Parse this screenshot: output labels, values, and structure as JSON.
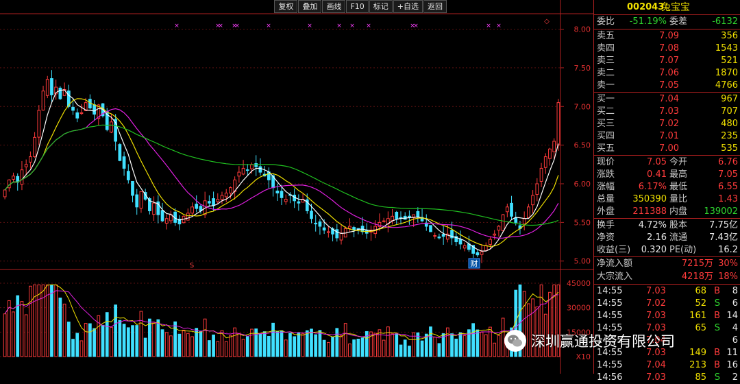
{
  "toolbar": [
    "复权",
    "叠加",
    "画线",
    "F10",
    "标记",
    "+自选",
    "返回"
  ],
  "stock": {
    "code": "002043",
    "name": "兔宝宝"
  },
  "committee": {
    "ratio_label": "委比",
    "ratio": "-51.19%",
    "diff_label": "委差",
    "diff": "-6132"
  },
  "asks": [
    {
      "label": "卖五",
      "price": "7.09",
      "vol": "356"
    },
    {
      "label": "卖四",
      "price": "7.08",
      "vol": "1543"
    },
    {
      "label": "卖三",
      "price": "7.07",
      "vol": "521"
    },
    {
      "label": "卖二",
      "price": "7.06",
      "vol": "1870"
    },
    {
      "label": "卖一",
      "price": "7.05",
      "vol": "4766"
    }
  ],
  "bids": [
    {
      "label": "买一",
      "price": "7.04",
      "vol": "967"
    },
    {
      "label": "买二",
      "price": "7.03",
      "vol": "707"
    },
    {
      "label": "买三",
      "price": "7.02",
      "vol": "480"
    },
    {
      "label": "买四",
      "price": "7.01",
      "vol": "235"
    },
    {
      "label": "买五",
      "price": "7.00",
      "vol": "535"
    }
  ],
  "quote": [
    {
      "l1": "现价",
      "v1": "7.05",
      "c1": "red",
      "l2": "今开",
      "v2": "6.76",
      "c2": "red"
    },
    {
      "l1": "涨跌",
      "v1": "0.41",
      "c1": "red",
      "l2": "最高",
      "v2": "7.05",
      "c2": "red"
    },
    {
      "l1": "涨幅",
      "v1": "6.17%",
      "c1": "red",
      "l2": "最低",
      "v2": "6.55",
      "c2": "red"
    },
    {
      "l1": "总量",
      "v1": "350390",
      "c1": "yellow",
      "l2": "量比",
      "v2": "1.43",
      "c2": "red"
    },
    {
      "l1": "外盘",
      "v1": "211388",
      "c1": "red",
      "l2": "内盘",
      "v2": "139002",
      "c2": "green"
    }
  ],
  "fundamentals": [
    {
      "l1": "换手",
      "v1": "4.72%",
      "l2": "股本",
      "v2": "7.75亿"
    },
    {
      "l1": "净资",
      "v1": "2.16",
      "l2": "流通",
      "v2": "7.43亿"
    },
    {
      "l1": "收益(三)",
      "v1": "0.320",
      "l2": "PE(动)",
      "v2": "16.2"
    }
  ],
  "flows": [
    {
      "label": "净流入额",
      "amount": "7215万",
      "pct": "30%"
    },
    {
      "label": "大宗流入",
      "amount": "4218万",
      "pct": "18%"
    }
  ],
  "ticks": [
    {
      "time": "14:55",
      "price": "7.03",
      "vol": "68",
      "side": "B",
      "n": "8"
    },
    {
      "time": "14:55",
      "price": "7.02",
      "vol": "52",
      "side": "S",
      "n": "6"
    },
    {
      "time": "14:55",
      "price": "7.03",
      "vol": "161",
      "side": "B",
      "n": "14"
    },
    {
      "time": "14:55",
      "price": "7.03",
      "vol": "65",
      "side": "S",
      "n": "4"
    },
    {
      "time": "14:55",
      "price": "7.04",
      "vol": "",
      "side": "",
      "n": "6"
    },
    {
      "time": "14:55",
      "price": "7.03",
      "vol": "149",
      "side": "B",
      "n": "11"
    },
    {
      "time": "14:55",
      "price": "7.04",
      "vol": "213",
      "side": "B",
      "n": "16"
    },
    {
      "time": "14:56",
      "price": "7.03",
      "vol": "85",
      "side": "S",
      "n": "2"
    }
  ],
  "price_axis": [
    "8.00",
    "7.50",
    "7.00",
    "6.50",
    "6.00",
    "5.50",
    "5.00"
  ],
  "vol_axis": [
    "45000",
    "30000",
    "15000",
    "X10"
  ],
  "markers": {
    "s_label": "S",
    "cai_label": "财"
  },
  "watermark": "深圳赢通投资有限公司",
  "colors": {
    "up": "#ff3b3b",
    "down": "#40e0ff",
    "ma5": "#ffffff",
    "ma10": "#f0e000",
    "ma20": "#e020e0",
    "ma60": "#20c020",
    "axis": "#b02020"
  },
  "chart_data": {
    "type": "candlestick",
    "ylim": [
      4.9,
      8.2
    ],
    "closes": [
      5.92,
      6.05,
      6.1,
      6.02,
      6.18,
      6.25,
      6.35,
      6.6,
      6.95,
      7.2,
      7.35,
      7.15,
      7.25,
      7.1,
      7.22,
      7.0,
      6.95,
      6.85,
      6.92,
      7.05,
      6.98,
      6.9,
      7.02,
      6.88,
      6.7,
      6.8,
      6.55,
      6.3,
      6.2,
      6.05,
      5.85,
      5.7,
      5.9,
      5.8,
      5.65,
      5.75,
      5.6,
      5.52,
      5.55,
      5.6,
      5.5,
      5.48,
      5.58,
      5.62,
      5.7,
      5.68,
      5.65,
      5.78,
      5.75,
      5.72,
      5.8,
      5.85,
      5.88,
      5.95,
      6.05,
      6.15,
      6.2,
      6.18,
      6.25,
      6.22,
      6.15,
      6.1,
      6.05,
      5.95,
      5.88,
      5.82,
      5.8,
      5.85,
      5.78,
      5.75,
      5.8,
      5.65,
      5.55,
      5.48,
      5.45,
      5.4,
      5.38,
      5.35,
      5.3,
      5.36,
      5.42,
      5.45,
      5.4,
      5.42,
      5.38,
      5.36,
      5.4,
      5.45,
      5.5,
      5.52,
      5.55,
      5.58,
      5.55,
      5.56,
      5.54,
      5.58,
      5.6,
      5.57,
      5.52,
      5.45,
      5.38,
      5.33,
      5.3,
      5.32,
      5.35,
      5.3,
      5.25,
      5.22,
      5.2,
      5.15,
      5.1,
      5.08,
      5.12,
      5.2,
      5.28,
      5.35,
      5.45,
      5.6,
      5.7,
      5.58,
      5.5,
      5.42,
      5.55,
      5.7,
      5.85,
      6.0,
      6.2,
      6.35,
      6.45,
      6.55,
      7.05
    ],
    "volume_ylim": [
      0,
      45000
    ]
  }
}
